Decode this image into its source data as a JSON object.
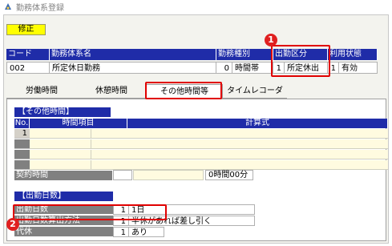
{
  "window": {
    "title": "勤務体系登録"
  },
  "mode_badge": "修正",
  "record": {
    "headers": [
      "コード",
      "勤務体系名",
      "勤務種別",
      "出勤区分",
      "利用状態"
    ],
    "values": {
      "code": "002",
      "name": "所定休日勤務",
      "work_type_num": "0",
      "work_type": "時間帯",
      "attendance_num": "1",
      "attendance": "所定休出",
      "status_num": "1",
      "status": "有効"
    }
  },
  "tabs": [
    "労働時間",
    "休憩時間",
    "その他時間等",
    "タイムレコーダ"
  ],
  "active_tab": "その他時間等",
  "other_time": {
    "title": "【その他時間】",
    "columns": [
      "No.",
      "時間項目",
      "計算式"
    ],
    "rows": [
      {
        "no": "1"
      },
      {
        "no": ""
      },
      {
        "no": ""
      },
      {
        "no": ""
      }
    ]
  },
  "contract_time": {
    "label": "契約時間",
    "value": "0時間00分"
  },
  "attendance_days": {
    "title": "【出勤日数】",
    "rows": [
      {
        "label": "出勤日数",
        "num": "1",
        "value": "1日"
      },
      {
        "label": "出勤日数算出方法",
        "num": "1",
        "value": "半休があれば差し引く"
      },
      {
        "label": "代休",
        "num": "1",
        "value": "あり"
      }
    ]
  },
  "markers": [
    "1",
    "2"
  ],
  "colors": {
    "header_blue": "#1f2ca8",
    "highlight_red": "#e00000",
    "badge_yellow": "#ffff00"
  }
}
